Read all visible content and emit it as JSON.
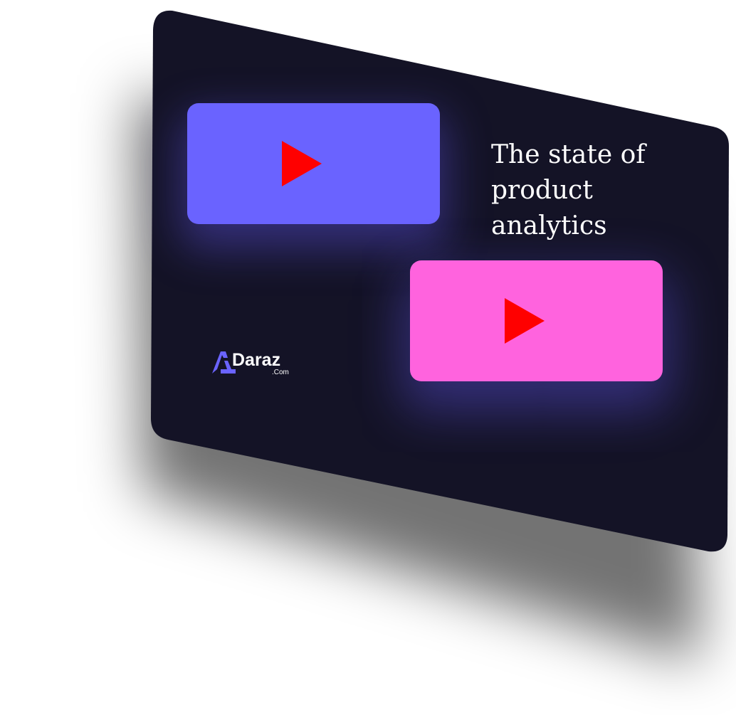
{
  "headline": {
    "line1": "The state of",
    "line2": "product",
    "line3": "analytics"
  },
  "logo": {
    "name": "Daraz",
    "suffix": ".Com",
    "mark_icon": "a-letter-logo-icon"
  },
  "videos": [
    {
      "icon": "play-icon",
      "color": "#6a63ff"
    },
    {
      "icon": "play-icon",
      "color": "#ff63de"
    }
  ],
  "colors": {
    "panel": "#141326",
    "glow": "#5a50dc",
    "play": "#ff0000",
    "logo_accent": "#6a63ff"
  }
}
